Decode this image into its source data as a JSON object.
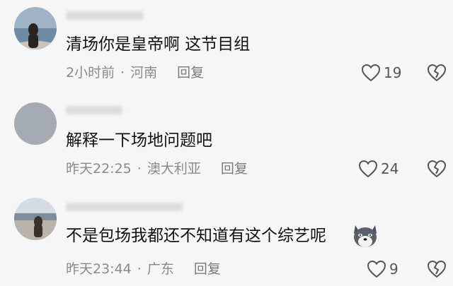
{
  "comments": [
    {
      "text": "清场你是皇帝啊 这节目组",
      "time": "2小时前",
      "dot": "·",
      "location": "河南",
      "reply_label": "回复",
      "likes": "19"
    },
    {
      "text": "解释一下场地问题吧",
      "time": "昨天22:25",
      "dot": "·",
      "location": "澳大利亚",
      "reply_label": "回复",
      "likes": "24"
    },
    {
      "text": "不是包场我都还不知道有这个综艺呢",
      "time": "昨天23:44",
      "dot": "·",
      "location": "广东",
      "reply_label": "回复",
      "likes": "9"
    }
  ],
  "icons": {
    "like": "heart-outline-icon",
    "dislike": "broken-heart-icon",
    "emoji": "husky-dog-emoji"
  },
  "colors": {
    "background": "#f6f6f6",
    "text": "#111111",
    "meta": "#8a8a8a"
  }
}
